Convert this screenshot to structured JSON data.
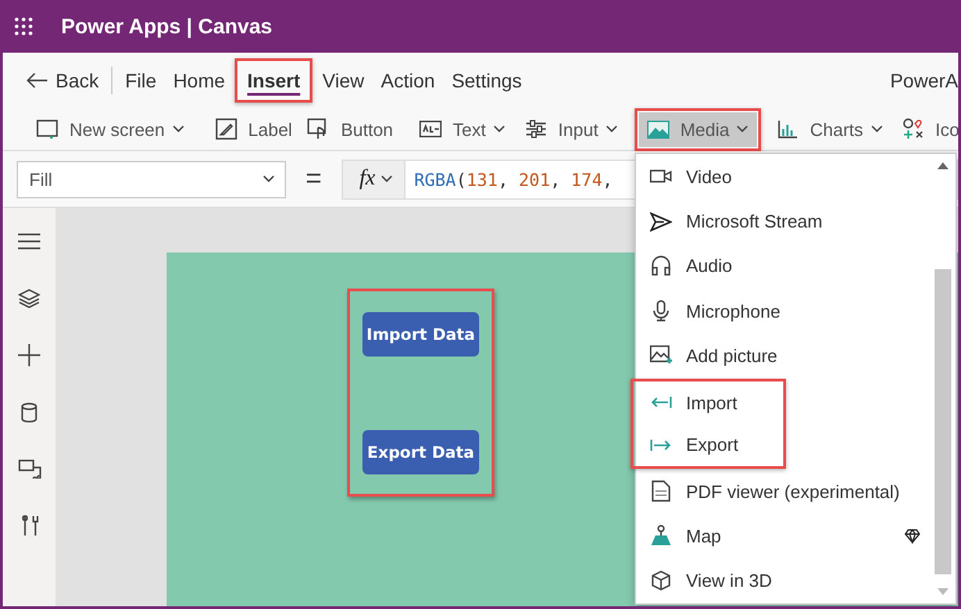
{
  "header": {
    "title": "Power Apps | Canvas"
  },
  "menubar": {
    "back": "Back",
    "tabs": [
      {
        "label": "File",
        "selected": false,
        "highlighted": false
      },
      {
        "label": "Home",
        "selected": false,
        "highlighted": false
      },
      {
        "label": "Insert",
        "selected": true,
        "highlighted": true
      },
      {
        "label": "View",
        "selected": false,
        "highlighted": false
      },
      {
        "label": "Action",
        "selected": false,
        "highlighted": false
      },
      {
        "label": "Settings",
        "selected": false,
        "highlighted": false
      }
    ],
    "right_text": "PowerA"
  },
  "toolbar": {
    "groups": [
      [
        {
          "label": "New screen",
          "kind": "screen",
          "has_menu": true,
          "selected": false,
          "highlighted": false
        }
      ],
      [
        {
          "label": "Label",
          "kind": "label",
          "has_menu": false,
          "selected": false,
          "highlighted": false
        },
        {
          "label": "Button",
          "kind": "button",
          "has_menu": false,
          "selected": false,
          "highlighted": false
        }
      ],
      [
        {
          "label": "Text",
          "kind": "text",
          "has_menu": true,
          "selected": false,
          "highlighted": false
        },
        {
          "label": "Input",
          "kind": "input",
          "has_menu": true,
          "selected": false,
          "highlighted": false
        },
        {
          "label": "Media",
          "kind": "media",
          "has_menu": true,
          "selected": true,
          "highlighted": true
        },
        {
          "label": "Charts",
          "kind": "charts",
          "has_menu": true,
          "selected": false,
          "highlighted": false
        },
        {
          "label": "Ico",
          "kind": "icons",
          "has_menu": false,
          "selected": false,
          "highlighted": false
        }
      ]
    ]
  },
  "formula_bar": {
    "property": "Fill",
    "equals": "=",
    "fx": "fx",
    "tokens": [
      {
        "text": "RGBA",
        "kind": "function"
      },
      {
        "text": "(",
        "kind": "punct"
      },
      {
        "text": "131",
        "kind": "number"
      },
      {
        "text": ", ",
        "kind": "punct"
      },
      {
        "text": "201",
        "kind": "number"
      },
      {
        "text": ", ",
        "kind": "punct"
      },
      {
        "text": "174",
        "kind": "number"
      },
      {
        "text": ",",
        "kind": "punct"
      }
    ]
  },
  "sidebar": {
    "items": [
      {
        "kind": "menu"
      },
      {
        "kind": "layers"
      },
      {
        "kind": "plus"
      },
      {
        "kind": "data"
      },
      {
        "kind": "media"
      },
      {
        "kind": "tools"
      }
    ]
  },
  "canvas": {
    "group_highlighted": true,
    "buttons": [
      {
        "label": "Import Data"
      },
      {
        "label": "Export Data"
      }
    ]
  },
  "media_menu": {
    "items": [
      {
        "label": "Video",
        "kind": "video",
        "highlighted": false,
        "premium": false
      },
      {
        "label": "Microsoft Stream",
        "kind": "stream",
        "highlighted": false,
        "premium": false
      },
      {
        "label": "Audio",
        "kind": "audio",
        "highlighted": false,
        "premium": false
      },
      {
        "label": "Microphone",
        "kind": "microphone",
        "highlighted": false,
        "premium": false
      },
      {
        "label": "Add picture",
        "kind": "picture",
        "highlighted": false,
        "premium": false
      },
      {
        "label": "Import",
        "kind": "import",
        "highlighted": true,
        "premium": false
      },
      {
        "label": "Export",
        "kind": "export",
        "highlighted": true,
        "premium": false
      },
      {
        "label": "PDF viewer (experimental)",
        "kind": "pdf",
        "highlighted": false,
        "premium": false
      },
      {
        "label": "Map",
        "kind": "map",
        "highlighted": false,
        "premium": true
      },
      {
        "label": "View in 3D",
        "kind": "cube",
        "highlighted": false,
        "premium": false
      }
    ]
  }
}
